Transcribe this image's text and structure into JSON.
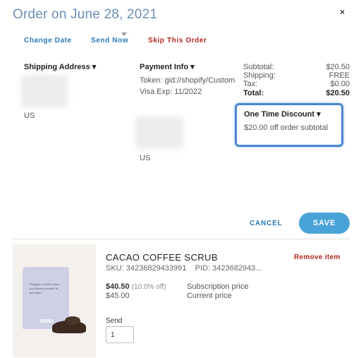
{
  "header": {
    "title": "Order on June 28, 2021",
    "close_glyph": "×"
  },
  "actions": {
    "change_date": "Change Date",
    "send_now": "Send Now",
    "skip_order": "Skip This Order"
  },
  "shipping": {
    "heading": "Shipping Address ▾",
    "country": "US"
  },
  "payment": {
    "heading": "Payment Info ▾",
    "token": "Token: gid://shopify/Custom",
    "visa_exp": "Visa Exp: 11/2022",
    "country": "US"
  },
  "summary": {
    "rows": [
      {
        "label": "Subtotal:",
        "value": "$20.50"
      },
      {
        "label": "Shipping:",
        "value": "FREE"
      },
      {
        "label": "Tax:",
        "value": "$0.00"
      },
      {
        "label": "Total:",
        "value": "$20.50"
      }
    ]
  },
  "discount": {
    "heading": "One Time Discount ▾",
    "value": "$20.00 off order subtotal",
    "highlight_color": "#4a86d4"
  },
  "footer": {
    "cancel": "CANCEL",
    "save": "SAVE"
  },
  "product": {
    "name": "CACAO COFFEE SCRUB",
    "remove": "Remove item",
    "sku_label": "SKU:",
    "sku": "34236829433991",
    "pid_label": "PID:",
    "pid": "3423682943...",
    "subscription_price": "$40.50",
    "discount_note": "(10.0% off)",
    "current_price": "$45.00",
    "subscription_label": "Subscription price",
    "current_label": "Current price",
    "send_label": "Send",
    "quantity": "1",
    "package_quote": "\"Imagine a world where you shower yourself in chocolate.\""
  },
  "colors": {
    "title": "#6b8fb8",
    "link_blue": "#2a79b5",
    "danger_red": "#b3261e",
    "save_button": "#4aa3d8"
  }
}
